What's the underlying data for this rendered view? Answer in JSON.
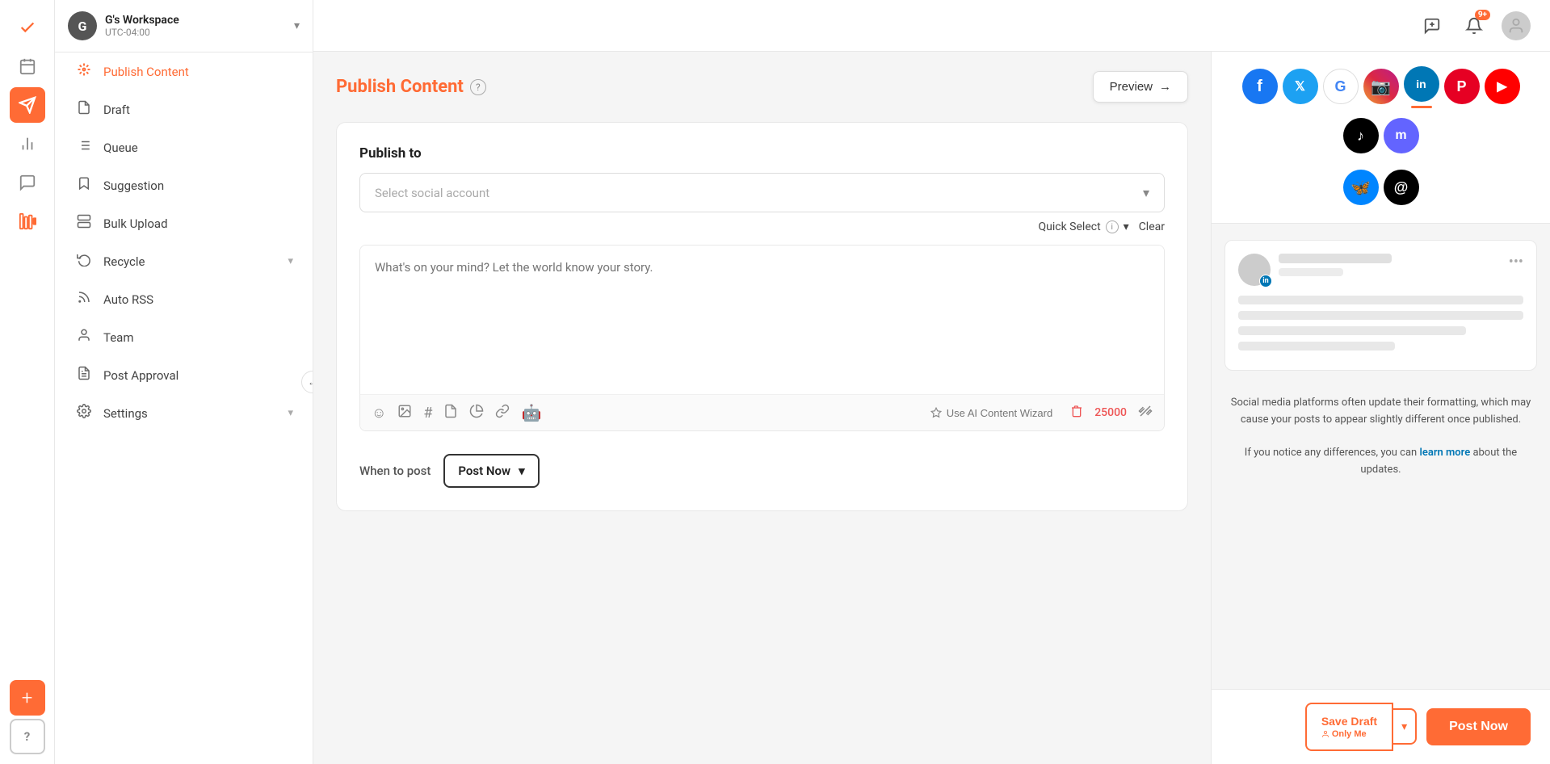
{
  "app": {
    "title": "Publish Content"
  },
  "workspace": {
    "initial": "G",
    "name": "G's Workspace",
    "timezone": "UTC-04:00",
    "chevron": "▾"
  },
  "sidebar": {
    "items": [
      {
        "id": "draft",
        "label": "Draft",
        "icon": "📄"
      },
      {
        "id": "queue",
        "label": "Queue",
        "icon": "☰"
      },
      {
        "id": "analytics",
        "label": "Analytics",
        "icon": "📊"
      },
      {
        "id": "messages",
        "label": "Messages",
        "icon": "💬"
      },
      {
        "id": "listening",
        "label": "Listening",
        "icon": "📻"
      },
      {
        "id": "suggestion",
        "label": "Suggestion",
        "icon": "🔖"
      },
      {
        "id": "bulk-upload",
        "label": "Bulk Upload",
        "icon": "📋"
      },
      {
        "id": "recycle",
        "label": "Recycle",
        "icon": "🗃️",
        "hasChevron": true
      },
      {
        "id": "auto-rss",
        "label": "Auto RSS",
        "icon": "📡"
      },
      {
        "id": "team",
        "label": "Team",
        "icon": "👤"
      },
      {
        "id": "post-approval",
        "label": "Post Approval",
        "icon": "📃"
      },
      {
        "id": "settings",
        "label": "Settings",
        "icon": "⚙️",
        "hasChevron": true
      }
    ],
    "active": "publish-content",
    "publish_content_label": "Publish Content"
  },
  "topbar": {
    "notification_count": "9+",
    "message_icon": "💬"
  },
  "publish": {
    "title": "Publish Content",
    "help_icon": "?",
    "preview_btn": "Preview →",
    "publish_to_label": "Publish to",
    "account_placeholder": "Select social account",
    "quick_select_label": "Quick Select",
    "clear_label": "Clear",
    "textarea_placeholder": "What's on your mind? Let the world know your story.",
    "ai_wizard_label": "Use AI Content Wizard",
    "char_count": "25000",
    "when_to_post_label": "When to post",
    "post_now_label": "Post Now"
  },
  "social_networks": [
    {
      "id": "facebook",
      "label": "Facebook",
      "symbol": "f",
      "class": "facebook",
      "active": false
    },
    {
      "id": "twitter",
      "label": "Twitter",
      "symbol": "𝕏",
      "class": "twitter",
      "active": false
    },
    {
      "id": "google",
      "label": "Google",
      "symbol": "G",
      "class": "google",
      "active": false
    },
    {
      "id": "instagram",
      "label": "Instagram",
      "symbol": "📷",
      "class": "instagram",
      "active": false
    },
    {
      "id": "linkedin",
      "label": "LinkedIn",
      "symbol": "in",
      "class": "linkedin",
      "active": true
    },
    {
      "id": "pinterest",
      "label": "Pinterest",
      "symbol": "P",
      "class": "pinterest",
      "active": false
    },
    {
      "id": "youtube",
      "label": "YouTube",
      "symbol": "▶",
      "class": "youtube",
      "active": false
    },
    {
      "id": "tiktok",
      "label": "TikTok",
      "symbol": "♪",
      "class": "tiktok",
      "active": false
    },
    {
      "id": "mastodon",
      "label": "Mastodon",
      "symbol": "m",
      "class": "mastodon",
      "active": false
    }
  ],
  "social_row2": [
    {
      "id": "bluesky",
      "label": "Bluesky",
      "symbol": "🦋",
      "class": "bluesky",
      "active": false
    },
    {
      "id": "threads",
      "label": "Threads",
      "symbol": "@",
      "class": "threads",
      "active": false
    }
  ],
  "preview": {
    "notice": "Social media platforms often update their formatting, which may cause your posts to appear slightly different once published.",
    "notice_link_text": "learn more",
    "notice_suffix": "about the updates.",
    "linkedin_badge": "in"
  },
  "bottom_bar": {
    "save_draft_label": "Save Draft",
    "only_me_label": "Only Me",
    "post_now_label": "Post Now"
  }
}
